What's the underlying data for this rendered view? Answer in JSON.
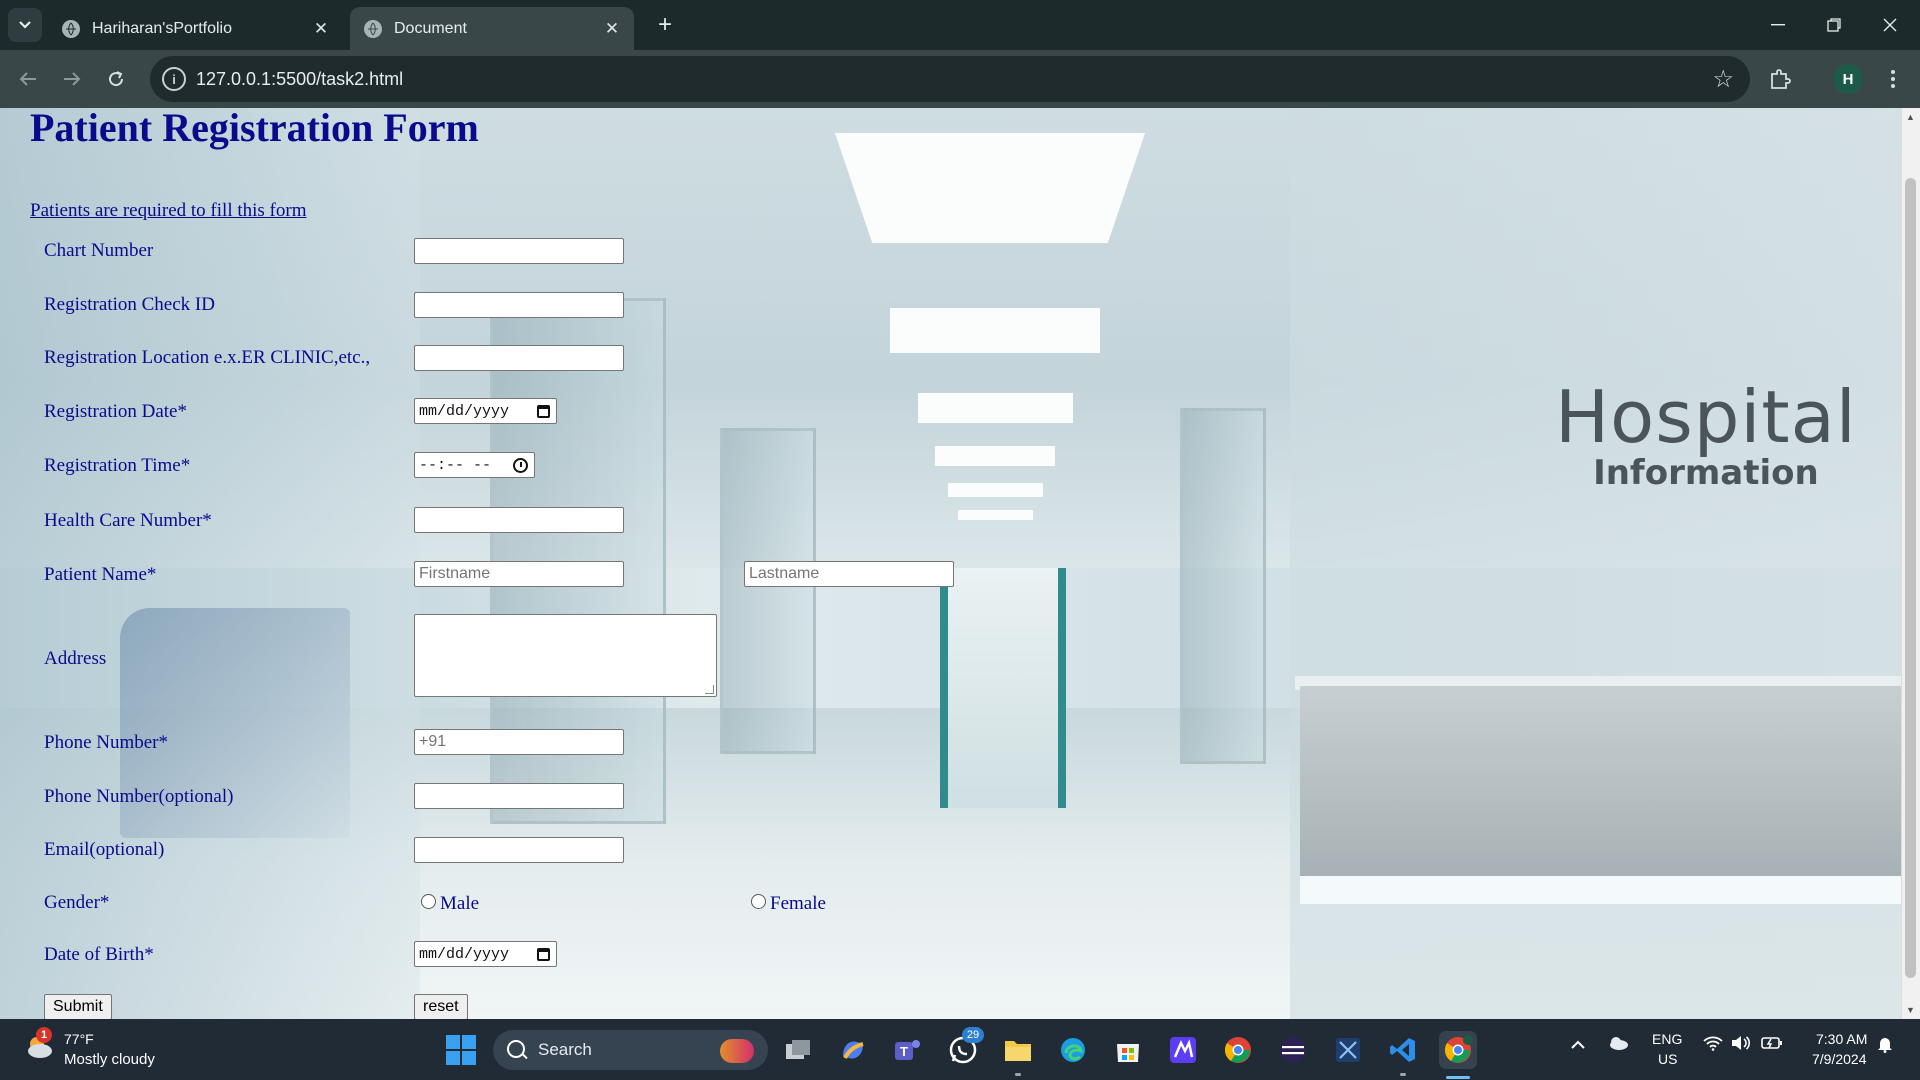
{
  "browser": {
    "tabs": [
      {
        "title": "Hariharan'sPortfolio"
      },
      {
        "title": "Document"
      }
    ],
    "url": "127.0.0.1:5500/task2.html",
    "profile_initial": "H"
  },
  "page": {
    "background_sign": {
      "line1": "Hospital",
      "line2": "Information"
    },
    "title": "Patient Registration Form",
    "note": "Patients are required to fill this form",
    "fields": {
      "chart_number": {
        "label": "Chart Number",
        "value": ""
      },
      "registration_check_id": {
        "label": "Registration Check ID",
        "value": ""
      },
      "registration_location": {
        "label": "Registration Location e.x.ER CLINIC,etc.,",
        "value": ""
      },
      "registration_date": {
        "label": "Registration Date*",
        "placeholder": "mm/dd/yyyy"
      },
      "registration_time": {
        "label": "Registration Time*",
        "placeholder": "--:-- --"
      },
      "health_care_number": {
        "label": "Health Care Number*",
        "value": ""
      },
      "patient_name": {
        "label": "Patient Name*",
        "first_placeholder": "Firstname",
        "last_placeholder": "Lastname"
      },
      "address": {
        "label": "Address",
        "value": ""
      },
      "phone_number": {
        "label": "Phone Number*",
        "placeholder": "+91"
      },
      "phone_optional": {
        "label": "Phone Number(optional)",
        "value": ""
      },
      "email_optional": {
        "label": "Email(optional)",
        "value": ""
      },
      "gender": {
        "label": "Gender*",
        "options": [
          "Male",
          "Female"
        ],
        "selected": null
      },
      "date_of_birth": {
        "label": "Date of Birth*",
        "placeholder": "mm/dd/yyyy"
      }
    },
    "buttons": {
      "submit": "Submit",
      "reset": "reset"
    }
  },
  "taskbar": {
    "weather": {
      "badge": "1",
      "temp": "77°F",
      "desc": "Mostly cloudy"
    },
    "search_label": "Search",
    "whatsapp_badge": "29",
    "language": {
      "line1": "ENG",
      "line2": "US"
    },
    "clock": {
      "time": "7:30 AM",
      "date": "7/9/2024"
    }
  },
  "colors": {
    "form_text": "#0a0a8c",
    "chrome_dark": "#1c2a2c",
    "chrome_toolbar": "#3a4749",
    "taskbar": "#202b35"
  }
}
